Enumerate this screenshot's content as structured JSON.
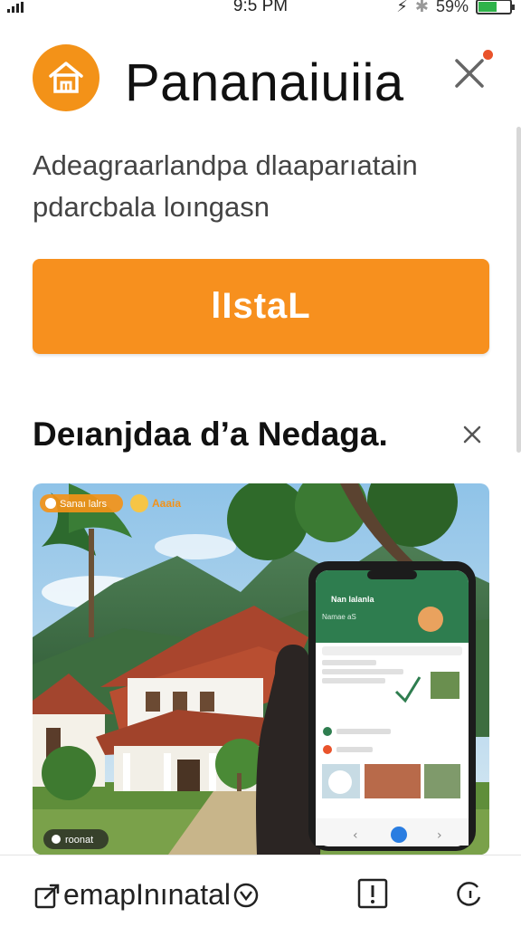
{
  "status_bar": {
    "time": "9:5 PM",
    "battery": "59%",
    "battery_level": 0.59
  },
  "header": {
    "app_name": "Pananaiuiia",
    "icon": "house-icon",
    "close_icon": "close-icon"
  },
  "description": "Adeagraarlandpa dlaaparıatain pdarcbala loıngasn",
  "install_button": {
    "label": "lIstaL"
  },
  "section": {
    "title": "Deıanjdaa d’a Nedaga.",
    "close_icon": "close-icon"
  },
  "promo": {
    "badge_left": "Sanaı lalrs",
    "badge_right": "Aaaia",
    "phone_header": "Nan Ialanla",
    "phone_subtitle": "Namae aS",
    "caption": "roonat"
  },
  "bottom_bar": {
    "link_text": "emapInınatal",
    "buttons": [
      "report-icon",
      "refresh-icon"
    ]
  },
  "colors": {
    "accent": "#f7901e",
    "icon_bg": "#f39218",
    "phone_green": "#2e7d4f",
    "battery": "#2fb34a"
  }
}
